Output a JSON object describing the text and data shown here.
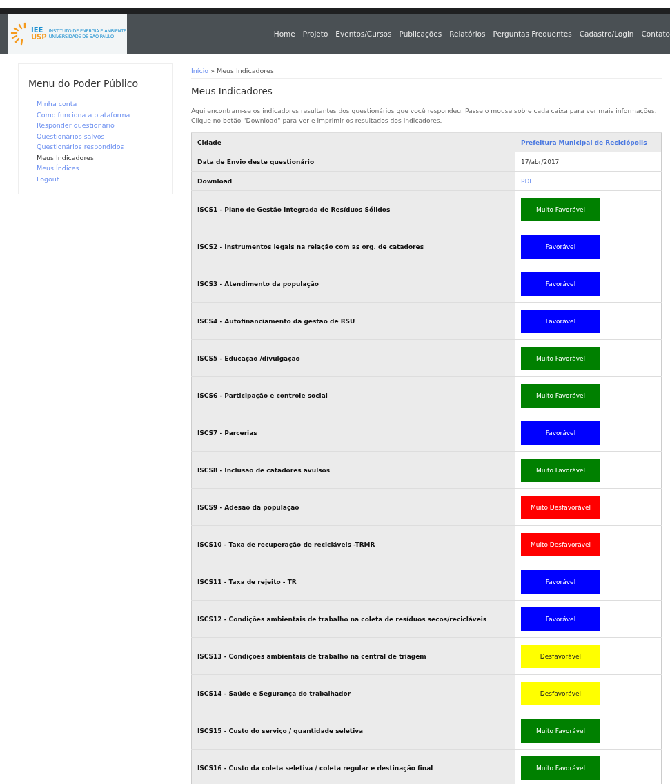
{
  "logo": {
    "mark_top": "IEE",
    "mark_bottom": "USP",
    "line_1": "INSTITUTO DE ENERGIA E AMBIENTE",
    "line_2": "UNIVERSIDADE DE SÃO PAULO"
  },
  "nav": [
    "Home",
    "Projeto",
    "Eventos/Cursos",
    "Publicações",
    "Relatórios",
    "Perguntas Frequentes",
    "Cadastro/Login",
    "Contato"
  ],
  "sidebar": {
    "title": "Menu do Poder Público",
    "items": [
      {
        "label": "Minha conta",
        "selected": false
      },
      {
        "label": "Como funciona a plataforma",
        "selected": false
      },
      {
        "label": "Responder questionário",
        "selected": false
      },
      {
        "label": "Questionários salvos",
        "selected": false
      },
      {
        "label": "Questionários respondidos",
        "selected": false
      },
      {
        "label": "Meus Indicadores",
        "selected": true
      },
      {
        "label": "Meus Índices",
        "selected": false
      },
      {
        "label": "Logout",
        "selected": false
      }
    ]
  },
  "breadcrumb": {
    "link": "Início",
    "separator": "»",
    "current": "Meus Indicadores"
  },
  "title": "Meus Indicadores",
  "intro": [
    "Aqui encontram-se os indicadores resultantes dos questionários que você respondeu. Passe o mouse sobre cada caixa para ver mais informações.",
    "Clique no botão \"Download\" para ver e imprimir os resultados dos indicadores."
  ],
  "info_rows": [
    {
      "label": "Cidade",
      "value": "Prefeitura Municipal de Reciclópolis",
      "kind": "city"
    },
    {
      "label": "Data de Envio deste questionário",
      "value": "17/abr/2017",
      "kind": "text"
    },
    {
      "label": "Download",
      "value": "PDF",
      "kind": "link"
    }
  ],
  "indicators": [
    {
      "name": "ISCS1 - Plano de Gestão Integrada de Resíduos Sólidos",
      "result": "Muito Favorável",
      "color": "#008000"
    },
    {
      "name": "ISCS2 - Instrumentos legais na relação com as org. de catadores",
      "result": "Favorável",
      "color": "#0000ff"
    },
    {
      "name": "ISCS3 - Atendimento da população",
      "result": "Favorável",
      "color": "#0000ff"
    },
    {
      "name": "ISCS4 - Autofinanciamento da gestão de RSU",
      "result": "Favorável",
      "color": "#0000ff"
    },
    {
      "name": "ISCS5 - Educação /divulgação",
      "result": "Muito Favorável",
      "color": "#008000"
    },
    {
      "name": "ISCS6 - Participação e controle social",
      "result": "Muito Favorável",
      "color": "#008000"
    },
    {
      "name": "ISCS7 - Parcerias",
      "result": "Favorável",
      "color": "#0000ff"
    },
    {
      "name": "ISCS8 - Inclusão de catadores avulsos",
      "result": "Muito Favorável",
      "color": "#008000"
    },
    {
      "name": "ISCS9 - Adesão da população",
      "result": "Muito Desfavorável",
      "color": "#ff0000"
    },
    {
      "name": "ISCS10 - Taxa de recuperação de recicláveis -TRMR",
      "result": "Muito Desfavorável",
      "color": "#ff0000"
    },
    {
      "name": "ISCS11 - Taxa de rejeito - TR",
      "result": "Favorável",
      "color": "#0000ff"
    },
    {
      "name": "ISCS12 - Condições ambientais de trabalho na coleta de resíduos secos/recicláveis",
      "result": "Favorável",
      "color": "#0000ff"
    },
    {
      "name": "ISCS13 - Condições ambientais de trabalho na central de triagem",
      "result": "Desfavorável",
      "color": "#ffff00"
    },
    {
      "name": "ISCS14 - Saúde e Segurança do trabalhador",
      "result": "Desfavorável",
      "color": "#ffff00"
    },
    {
      "name": "ISCS15 - Custo do serviço / quantidade seletiva",
      "result": "Muito Favorável",
      "color": "#008000"
    },
    {
      "name": "ISCS16 - Custo da coleta seletiva / coleta regular e destinação final",
      "result": "Muito Favorável",
      "color": "#008000"
    }
  ]
}
